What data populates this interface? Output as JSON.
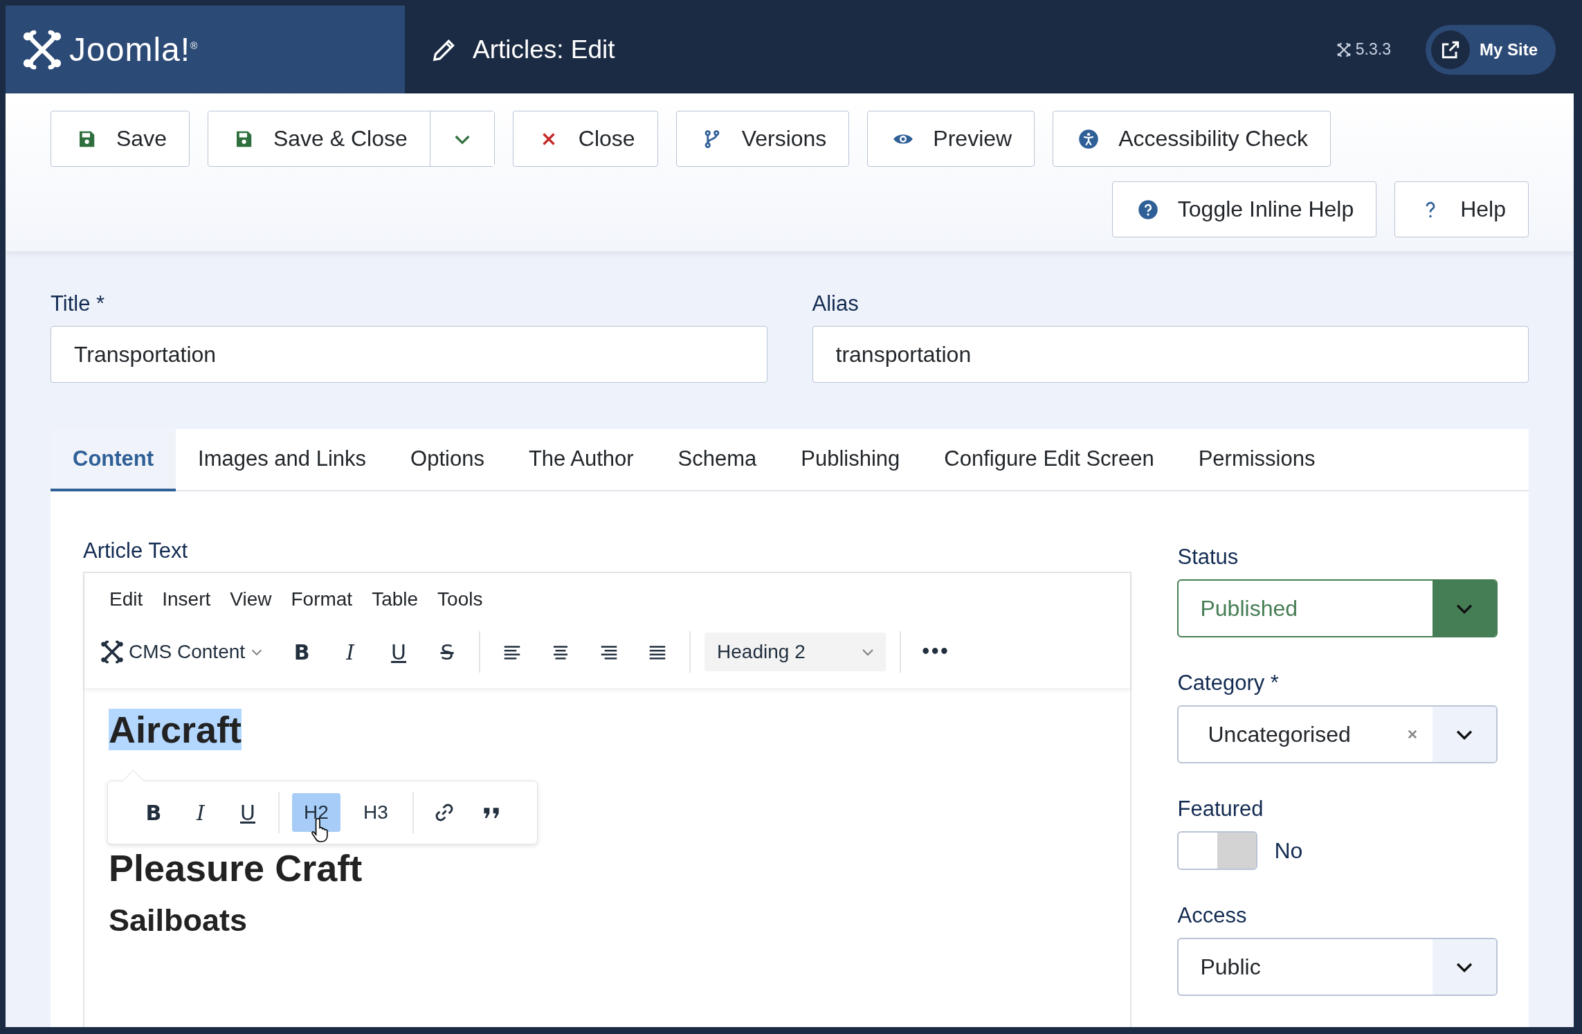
{
  "header": {
    "logo_text": "Joomla!$^{®}$",
    "title": "Articles: Edit",
    "version": "5.3.3",
    "site_button": "My Site"
  },
  "toolbar": {
    "buttons": [
      {
        "label": "Save",
        "kind": "save"
      },
      {
        "label": "Save & Close",
        "kind": "save",
        "dropdown": true
      },
      {
        "label": "Close",
        "kind": "close"
      },
      {
        "label": "Versions",
        "kind": "versions"
      },
      {
        "label": "Preview",
        "kind": "preview"
      },
      {
        "label": "Accessibility Check",
        "kind": "accessibility"
      }
    ],
    "help_buttons": [
      {
        "label": "Toggle Inline Help",
        "kind": "info"
      },
      {
        "label": "Help",
        "kind": "question"
      }
    ]
  },
  "fields": [
    {
      "label": "Title *",
      "value": "Transportation"
    },
    {
      "label": "Alias",
      "value": "transportation"
    }
  ],
  "tabs": [
    {
      "label": "Content",
      "selected": true
    },
    {
      "label": "Images and Links",
      "selected": false
    },
    {
      "label": "Options",
      "selected": false
    },
    {
      "label": "The Author",
      "selected": false
    },
    {
      "label": "Schema",
      "selected": false
    },
    {
      "label": "Publishing",
      "selected": false
    },
    {
      "label": "Configure Edit Screen",
      "selected": false
    },
    {
      "label": "Permissions",
      "selected": false
    }
  ],
  "editor": {
    "label": "Article Text",
    "menu": [
      "Edit",
      "Insert",
      "View",
      "Format",
      "Table",
      "Tools"
    ],
    "block_menu": "CMS Content",
    "format_buttons": [
      {
        "kind": "bold",
        "text": "B"
      },
      {
        "kind": "italic",
        "text": "I"
      },
      {
        "kind": "underline",
        "text": "U"
      },
      {
        "kind": "strike",
        "text": "S"
      }
    ],
    "align_buttons": [
      {
        "kind": "left"
      },
      {
        "kind": "center"
      },
      {
        "kind": "right"
      },
      {
        "kind": "justify"
      }
    ],
    "style_select": "Heading 2",
    "more": "•••",
    "content": [
      {
        "text": "Aircraft",
        "kind": "large",
        "selected": true
      },
      {
        "text": "Pleasure Craft",
        "kind": "large",
        "selected": false
      },
      {
        "text": "Sailboats",
        "kind": "medium",
        "selected": false
      }
    ],
    "popup": {
      "format_buttons": [
        {
          "kind": "bold",
          "text": "B"
        },
        {
          "kind": "italic",
          "text": "I"
        },
        {
          "kind": "underline",
          "text": "U"
        }
      ],
      "headings": [
        {
          "text": "H2",
          "selected": true
        },
        {
          "text": "H3",
          "selected": false
        }
      ],
      "icons": [
        {
          "kind": "link"
        },
        {
          "kind": "quote"
        }
      ]
    }
  },
  "sidebar": [
    {
      "kind": "select",
      "label": "Status",
      "value": "Published",
      "color": "#457d54"
    },
    {
      "kind": "select",
      "label": "Category *",
      "value": "Uncategorised",
      "clearable": true
    },
    {
      "kind": "toggle",
      "label": "Featured",
      "on": false,
      "value": "No"
    },
    {
      "kind": "select",
      "label": "Access",
      "value": "Public"
    }
  ]
}
